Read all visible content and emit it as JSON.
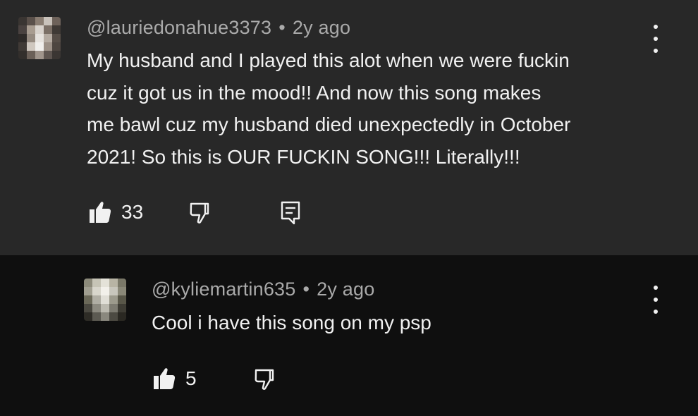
{
  "comments": [
    {
      "author": "@lauriedonahue3373",
      "separator": "•",
      "age": "2y ago",
      "text": "My husband and I played this alot when we were fuckin\ncuz it got us in the mood!! And now this song makes\nme bawl cuz my husband died unexpectedly in October\n2021! So this is OUR FUCKIN SONG!!! Literally!!!",
      "like_count": "33",
      "icons": {
        "like": "thumbs-up-icon",
        "dislike": "thumbs-down-icon",
        "reply": "reply-icon",
        "menu": "kebab-menu-icon"
      },
      "avatar_palette": [
        "#3a3532",
        "#5a504a",
        "#8a7d72",
        "#c9c2bb",
        "#6e625a",
        "#4a4240",
        "#a89c90",
        "#d8d2cc",
        "#7b6f66",
        "#3f3935",
        "#2e2a28",
        "#958a80",
        "#e6e2de",
        "#b5aba2",
        "#564d47",
        "#403a36",
        "#cfc7bf",
        "#f0eeec",
        "#9c9087",
        "#4d4540",
        "#332f2c",
        "#6b6058",
        "#a0958c",
        "#5e5550",
        "#3b3633"
      ]
    },
    {
      "author": "@kyliemartin635",
      "separator": "•",
      "age": "2y ago",
      "text": "Cool i have this song on my psp",
      "like_count": "5",
      "icons": {
        "like": "thumbs-up-icon",
        "dislike": "thumbs-down-icon",
        "menu": "kebab-menu-icon"
      },
      "avatar_palette": [
        "#8c8a7a",
        "#c6c4b6",
        "#e4e2d8",
        "#b8b4a4",
        "#7a7868",
        "#a09e90",
        "#d8d6cc",
        "#f2f0ea",
        "#c8c6bc",
        "#8a8878",
        "#6a6858",
        "#b0aea4",
        "#e0ded6",
        "#9c9a8c",
        "#585648",
        "#4a4840",
        "#8c8a80",
        "#bcbab0",
        "#7c7a70",
        "#3e3c34",
        "#2e2c26",
        "#5c5a52",
        "#8a887e",
        "#4c4a42",
        "#2a2822"
      ]
    }
  ],
  "colors": {
    "top_background": "#282828",
    "reply_background": "#0f0f0f",
    "meta_text": "#aaaaaa",
    "primary_text": "#f1f1f1"
  }
}
